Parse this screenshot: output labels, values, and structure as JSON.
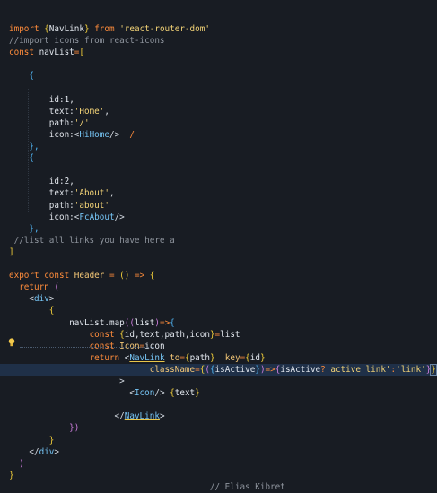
{
  "editor": {
    "lines": [
      [
        {
          "t": "import ",
          "c": "kw"
        },
        {
          "t": "{",
          "c": "br1"
        },
        {
          "t": "NavLink",
          "c": "ident"
        },
        {
          "t": "}",
          "c": "br1"
        },
        {
          "t": " from ",
          "c": "kw"
        },
        {
          "t": "'react-router-dom'",
          "c": "str"
        }
      ],
      [
        {
          "t": "//import icons from react-icons",
          "c": "cmt"
        }
      ],
      [
        {
          "t": "const ",
          "c": "kw"
        },
        {
          "t": "navList",
          "c": "ident"
        },
        {
          "t": "=",
          "c": "kw"
        },
        {
          "t": "[",
          "c": "br1"
        }
      ],
      [],
      [
        {
          "t": "    ",
          "c": "pun"
        },
        {
          "t": "{",
          "c": "br3"
        }
      ],
      [],
      [
        {
          "t": "        id:",
          "c": "white"
        },
        {
          "t": "1",
          "c": "num"
        },
        {
          "t": ",",
          "c": "white"
        }
      ],
      [
        {
          "t": "        text:",
          "c": "white"
        },
        {
          "t": "'Home'",
          "c": "str"
        },
        {
          "t": ",",
          "c": "white"
        }
      ],
      [
        {
          "t": "        path:",
          "c": "white"
        },
        {
          "t": "'/'",
          "c": "str"
        }
      ],
      [
        {
          "t": "        icon:",
          "c": "white"
        },
        {
          "t": "<",
          "c": "jsx"
        },
        {
          "t": "HiHome",
          "c": "tag"
        },
        {
          "t": "/>",
          "c": "jsx"
        },
        {
          "t": "  /",
          "c": "kw"
        }
      ],
      [
        {
          "t": "    ",
          "c": "pun"
        },
        {
          "t": "},",
          "c": "br3"
        }
      ],
      [
        {
          "t": "    ",
          "c": "pun"
        },
        {
          "t": "{",
          "c": "br3"
        }
      ],
      [],
      [
        {
          "t": "        id:",
          "c": "white"
        },
        {
          "t": "2",
          "c": "num"
        },
        {
          "t": ",",
          "c": "white"
        }
      ],
      [
        {
          "t": "        text:",
          "c": "white"
        },
        {
          "t": "'About'",
          "c": "str"
        },
        {
          "t": ",",
          "c": "white"
        }
      ],
      [
        {
          "t": "        path:",
          "c": "white"
        },
        {
          "t": "'about'",
          "c": "str"
        }
      ],
      [
        {
          "t": "        icon:",
          "c": "white"
        },
        {
          "t": "<",
          "c": "jsx"
        },
        {
          "t": "FcAbout",
          "c": "tag"
        },
        {
          "t": "/>",
          "c": "jsx"
        }
      ],
      [
        {
          "t": "    ",
          "c": "pun"
        },
        {
          "t": "},",
          "c": "br3"
        }
      ],
      [
        {
          "t": " //list all links you have here a",
          "c": "cmt"
        }
      ],
      [
        {
          "t": "]",
          "c": "br1"
        }
      ],
      [],
      [
        {
          "t": "export ",
          "c": "kw"
        },
        {
          "t": "const ",
          "c": "kw"
        },
        {
          "t": "Header",
          "c": "attr"
        },
        {
          "t": " = ",
          "c": "kw"
        },
        {
          "t": "()",
          "c": "br1"
        },
        {
          "t": " => ",
          "c": "kw"
        },
        {
          "t": "{",
          "c": "br1"
        }
      ],
      [
        {
          "t": "  return ",
          "c": "kw"
        },
        {
          "t": "(",
          "c": "br2"
        }
      ],
      [
        {
          "t": "    ",
          "c": "pun"
        },
        {
          "t": "<",
          "c": "jsx"
        },
        {
          "t": "div",
          "c": "tag"
        },
        {
          "t": ">",
          "c": "jsx"
        }
      ],
      [
        {
          "t": "        ",
          "c": "pun"
        },
        {
          "t": "{",
          "c": "br1"
        }
      ],
      [
        {
          "t": "            navList",
          "c": "ident"
        },
        {
          "t": ".",
          "c": "white"
        },
        {
          "t": "map",
          "c": "ident"
        },
        {
          "t": "((",
          "c": "br2"
        },
        {
          "t": "list",
          "c": "ident"
        },
        {
          "t": ")",
          "c": "br2"
        },
        {
          "t": "=>",
          "c": "kw"
        },
        {
          "t": "{",
          "c": "br3"
        }
      ],
      [
        {
          "t": "                ",
          "c": "pun"
        },
        {
          "t": "const ",
          "c": "kw"
        },
        {
          "t": "{",
          "c": "br1"
        },
        {
          "t": "id,text,path,icon",
          "c": "ident"
        },
        {
          "t": "}",
          "c": "br1"
        },
        {
          "t": "=",
          "c": "kw"
        },
        {
          "t": "list",
          "c": "ident"
        }
      ],
      [
        {
          "t": "                ",
          "c": "pun"
        },
        {
          "t": "const ",
          "c": "kw"
        },
        {
          "t": "Icon",
          "c": "attr"
        },
        {
          "t": "=",
          "c": "kw"
        },
        {
          "t": "icon",
          "c": "ident"
        }
      ],
      [
        {
          "t": "                ",
          "c": "pun"
        },
        {
          "t": "return ",
          "c": "kw"
        },
        {
          "t": "<",
          "c": "jsx"
        },
        {
          "t": "NavLink",
          "c": "tag",
          "u": true
        },
        {
          "t": " to",
          "c": "attr"
        },
        {
          "t": "=",
          "c": "kw"
        },
        {
          "t": "{",
          "c": "br1"
        },
        {
          "t": "path",
          "c": "ident"
        },
        {
          "t": "}",
          "c": "br1"
        },
        {
          "t": "  key",
          "c": "attr"
        },
        {
          "t": "=",
          "c": "kw"
        },
        {
          "t": "{",
          "c": "br1"
        },
        {
          "t": "id",
          "c": "ident"
        },
        {
          "t": "}",
          "c": "br1"
        }
      ],
      [
        {
          "t": "                            ",
          "c": "pun"
        },
        {
          "t": "className",
          "c": "attr"
        },
        {
          "t": "=",
          "c": "kw"
        },
        {
          "t": "{",
          "c": "br1"
        },
        {
          "t": "(",
          "c": "br2"
        },
        {
          "t": "{",
          "c": "br3"
        },
        {
          "t": "isActive",
          "c": "ident"
        },
        {
          "t": "}",
          "c": "br3"
        },
        {
          "t": ")",
          "c": "br2"
        },
        {
          "t": "=>",
          "c": "kw"
        },
        {
          "t": "{",
          "c": "br2"
        },
        {
          "t": "isActive",
          "c": "ident"
        },
        {
          "t": "?",
          "c": "kw"
        },
        {
          "t": "'active link'",
          "c": "str"
        },
        {
          "t": ":",
          "c": "kw"
        },
        {
          "t": "'link'",
          "c": "str"
        },
        {
          "t": "}",
          "c": "br2"
        },
        {
          "t": "}",
          "c": "br1",
          "box": true
        }
      ],
      [
        {
          "t": "                      >",
          "c": "jsx"
        }
      ],
      [
        {
          "t": "                        ",
          "c": "pun"
        },
        {
          "t": "<",
          "c": "jsx"
        },
        {
          "t": "Icon",
          "c": "tag"
        },
        {
          "t": "/> ",
          "c": "jsx"
        },
        {
          "t": "{",
          "c": "br1"
        },
        {
          "t": "text",
          "c": "ident"
        },
        {
          "t": "}",
          "c": "br1"
        }
      ],
      [],
      [
        {
          "t": "                     ",
          "c": "pun"
        },
        {
          "t": "</",
          "c": "jsx"
        },
        {
          "t": "NavLink",
          "c": "tag",
          "u": true
        },
        {
          "t": ">",
          "c": "jsx"
        }
      ],
      [
        {
          "t": "            ",
          "c": "pun"
        },
        {
          "t": "})",
          "c": "br2"
        }
      ],
      [
        {
          "t": "        ",
          "c": "pun"
        },
        {
          "t": "}",
          "c": "br1"
        }
      ],
      [
        {
          "t": "    ",
          "c": "pun"
        },
        {
          "t": "</",
          "c": "jsx"
        },
        {
          "t": "div",
          "c": "tag"
        },
        {
          "t": ">",
          "c": "jsx"
        }
      ],
      [
        {
          "t": "  ",
          "c": "pun"
        },
        {
          "t": ")",
          "c": "br2"
        }
      ],
      [
        {
          "t": "}",
          "c": "br1"
        }
      ],
      [
        {
          "t": "                                        // Elias Kibret",
          "c": "cmt"
        }
      ]
    ],
    "highlight_line_index": 29,
    "lightbulb_icon": "lightbulb-icon"
  },
  "colors": {
    "background": "#181c23",
    "keyword": "#ff8c3b",
    "string": "#f4d477",
    "comment": "#8f959e",
    "tag": "#76c5f5",
    "highlight": "#1f3048"
  }
}
